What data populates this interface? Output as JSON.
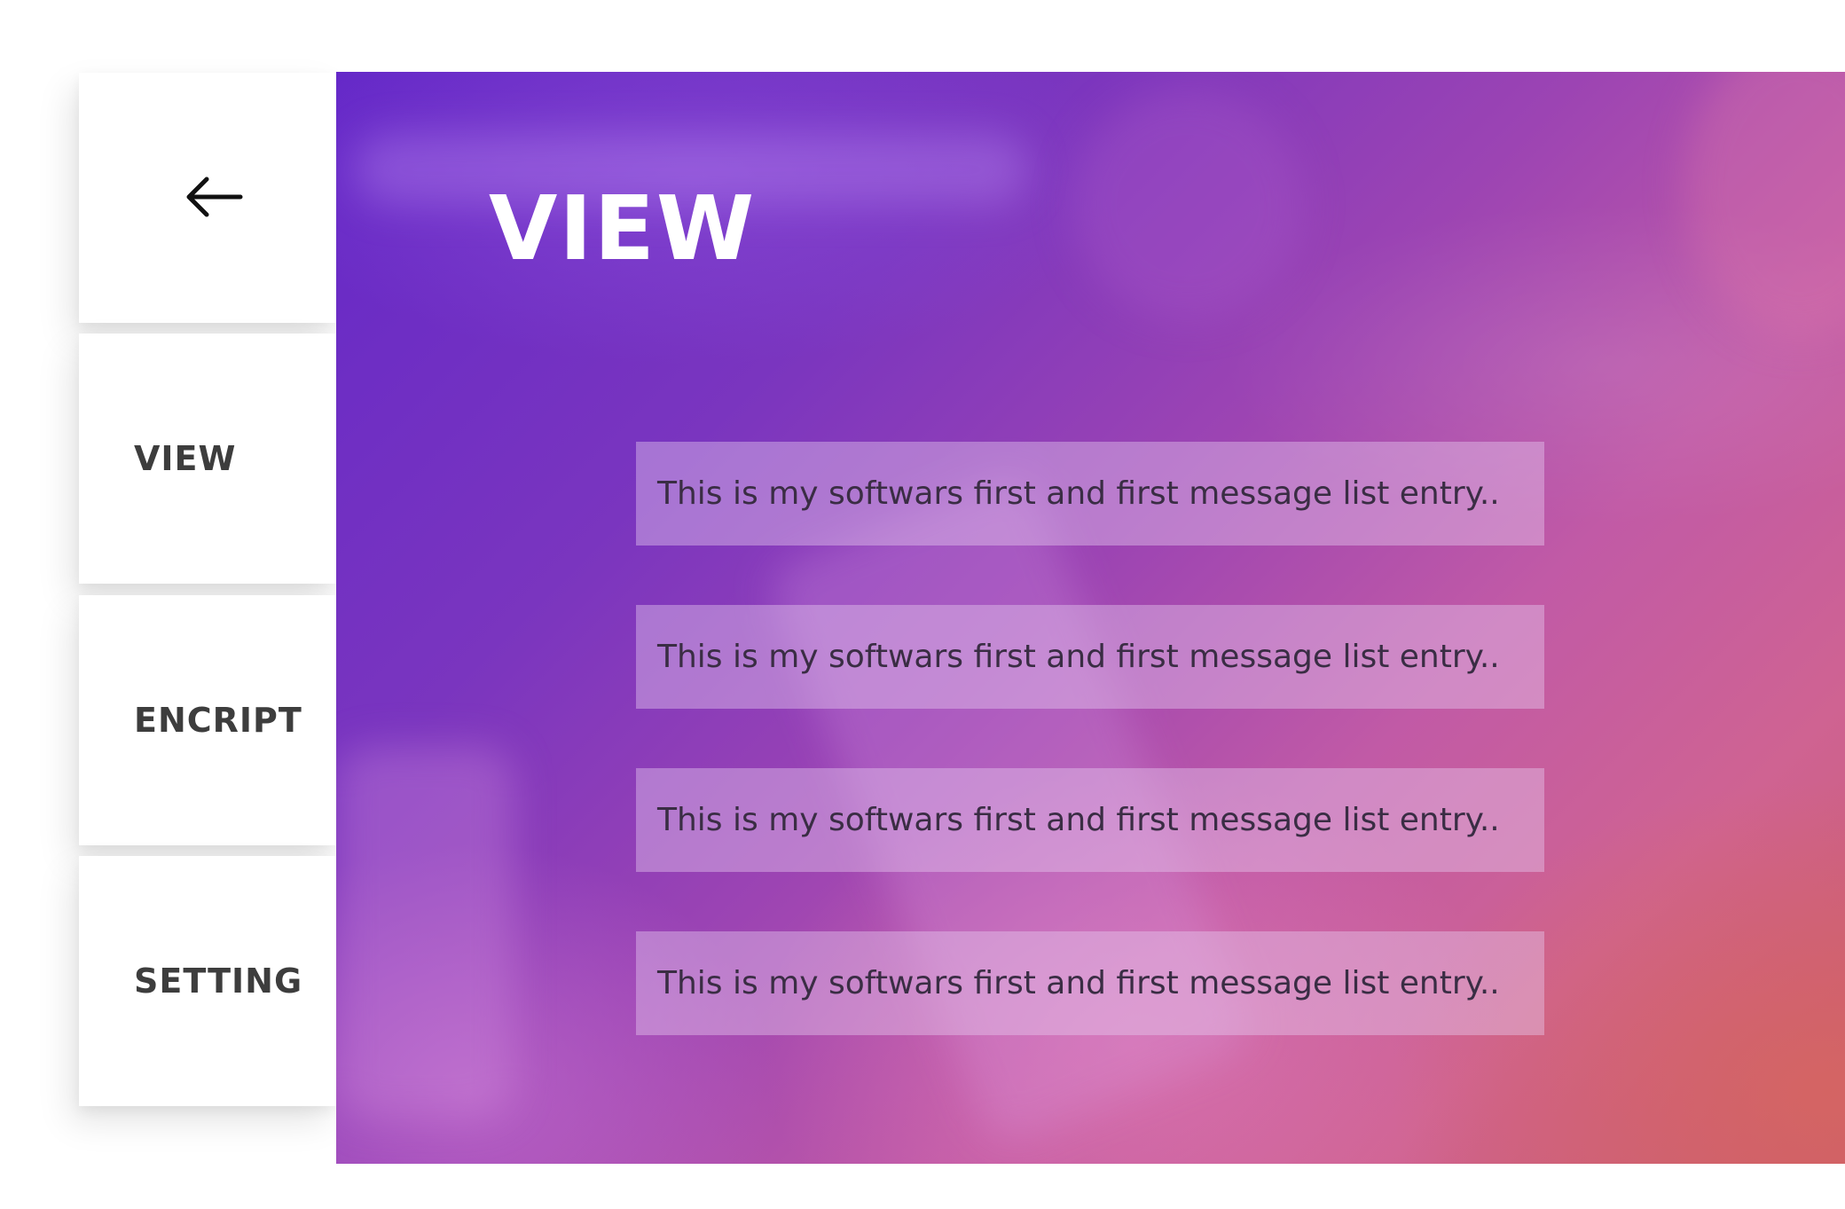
{
  "sidebar": {
    "back_icon": "arrow-left-icon",
    "items": [
      {
        "label": "VIEW"
      },
      {
        "label": "ENCRIPT"
      },
      {
        "label": "SETTING"
      }
    ]
  },
  "main": {
    "title": "VIEW",
    "messages": [
      "This is my softwars first and first message list entry..",
      "This is my softwars first and first message list entry..",
      "This is my softwars first and first message list entry..",
      "This is my softwars first and first message list entry.."
    ]
  },
  "colors": {
    "gradient_start": "#6428c8",
    "gradient_end": "#c95a6e",
    "sidebar_text": "#3d3d3d",
    "title_text": "#ffffff"
  }
}
